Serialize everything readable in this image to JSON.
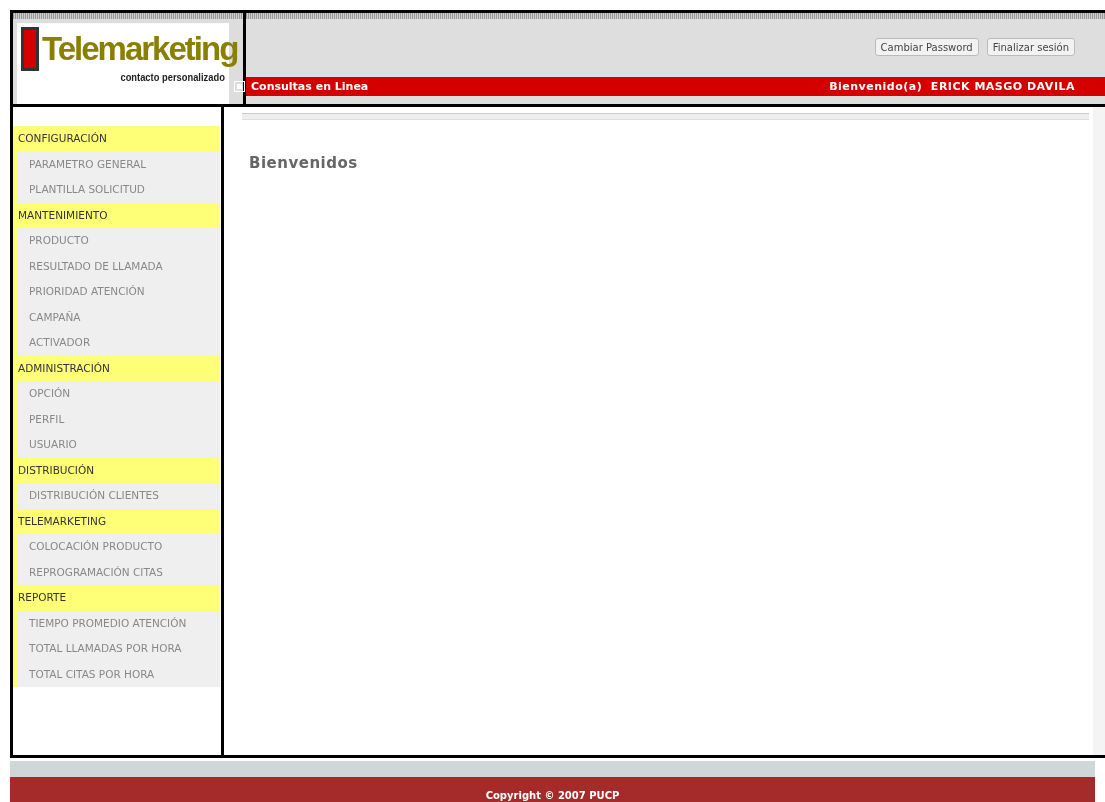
{
  "logo": {
    "title": "Telemarketing",
    "tagline": "contacto personalizado"
  },
  "header": {
    "buttons": [
      "Cambiar Password",
      "Finalizar sesión"
    ],
    "section": "Consultas en Linea",
    "welcome": "Bienvenido(a)  ERICK MASGO DAVILA"
  },
  "sidebar": {
    "groups": [
      {
        "label": "CONFIGURACIÓN",
        "items": [
          "PARAMETRO GENERAL",
          "PLANTILLA SOLICITUD"
        ]
      },
      {
        "label": "MANTENIMIENTO",
        "items": [
          "PRODUCTO",
          "RESULTADO DE LLAMADA",
          "PRIORIDAD ATENCIÓN",
          "CAMPAÑA",
          "ACTIVADOR"
        ]
      },
      {
        "label": "ADMINISTRACIÓN",
        "items": [
          "OPCIÓN",
          "PERFIL",
          "USUARIO"
        ]
      },
      {
        "label": "DISTRIBUCIÓN",
        "items": [
          "DISTRIBUCIÓN CLIENTES"
        ]
      },
      {
        "label": "TELEMARKETING",
        "items": [
          "COLOCACIÓN PRODUCTO",
          "REPROGRAMACIÓN CITAS"
        ]
      },
      {
        "label": "REPORTE",
        "items": [
          "TIEMPO PROMEDIO ATENCIÓN",
          "TOTAL LLAMADAS POR HORA",
          "TOTAL CITAS POR HORA"
        ]
      }
    ]
  },
  "content": {
    "heading": "Bienvenidos"
  },
  "footer": {
    "copyright": "Copyright © 2007 PUCP"
  }
}
